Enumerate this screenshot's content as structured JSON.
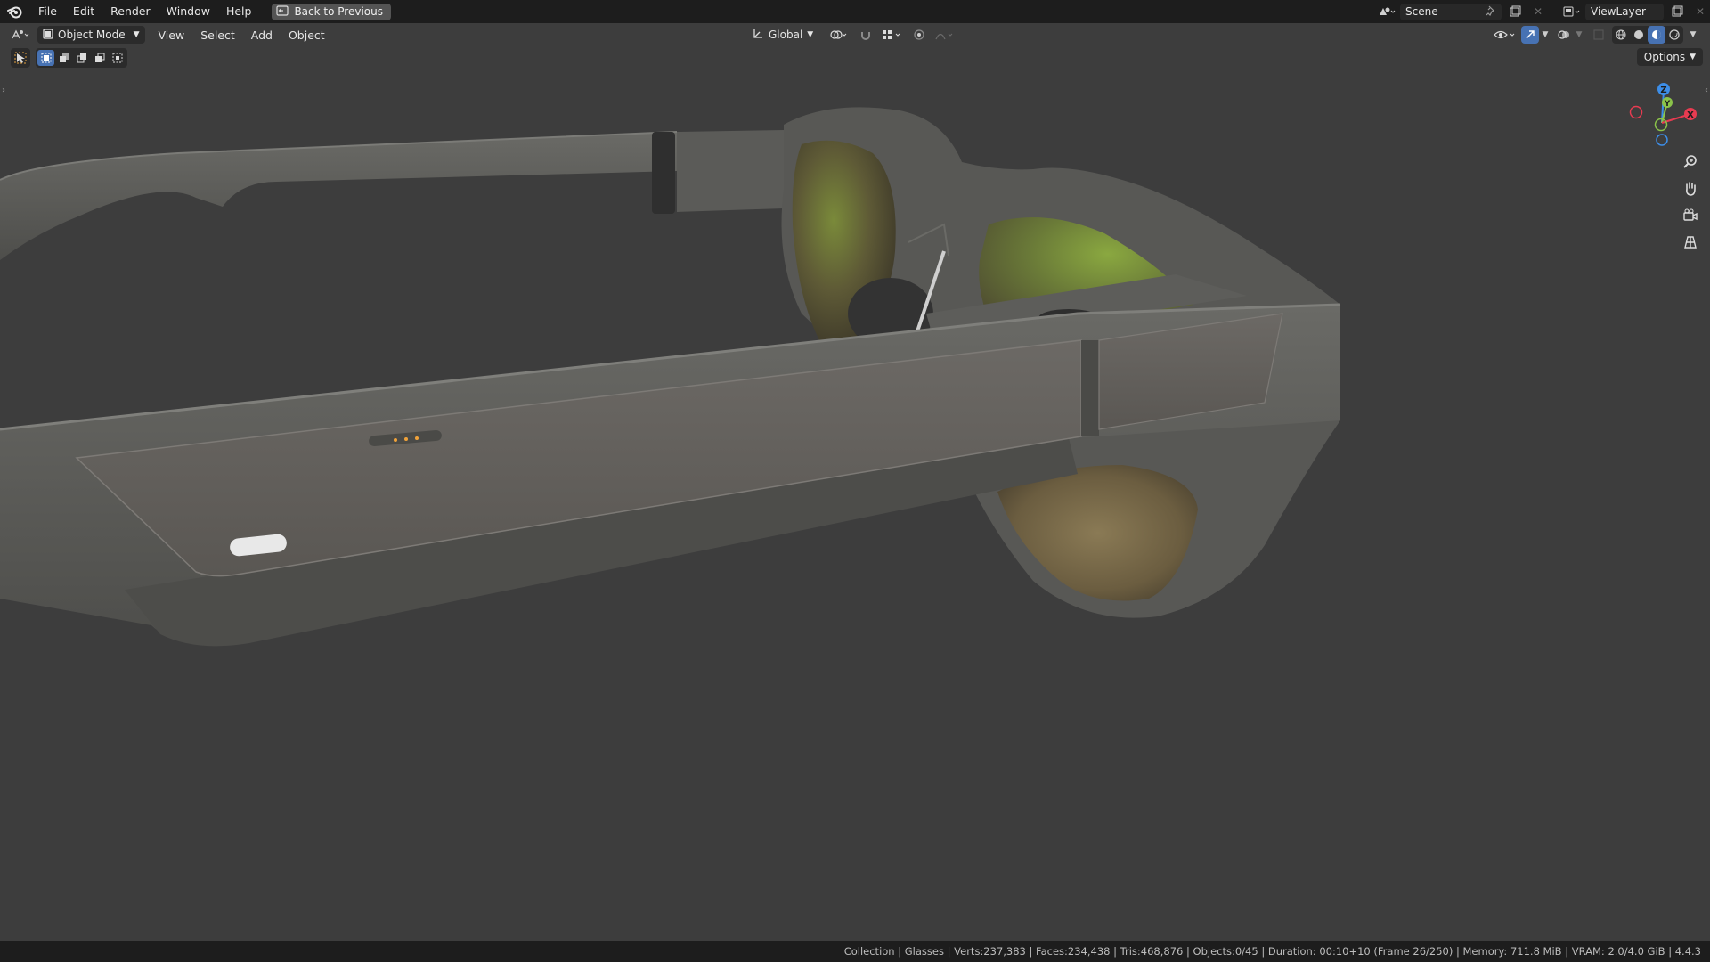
{
  "menubar": {
    "items": [
      "File",
      "Edit",
      "Render",
      "Window",
      "Help"
    ],
    "back_button": "Back to Previous"
  },
  "scene_selector": {
    "value": "Scene"
  },
  "viewlayer_selector": {
    "value": "ViewLayer"
  },
  "viewport_header": {
    "mode": "Object Mode",
    "menus": [
      "View",
      "Select",
      "Add",
      "Object"
    ],
    "transform_orientation": "Global"
  },
  "toolbar": {
    "options_label": "Options"
  },
  "gizmo": {
    "axes": [
      "X",
      "Y",
      "Z"
    ]
  },
  "statusbar": {
    "text": "Collection | Glasses | Verts:237,383 | Faces:234,438 | Tris:468,876 | Objects:0/45 | Duration: 00:10+10 (Frame 26/250) | Memory: 711.8 MiB | VRAM: 2.0/4.0 GiB | 4.4.3"
  },
  "colors": {
    "accent": "#4772b3",
    "x_axis": "#e83b51",
    "y_axis": "#8bc34a",
    "z_axis": "#3d8ee8",
    "viewport_bg": "#3d3d3d"
  },
  "icons": [
    "blender-logo-icon",
    "editor-type-icon",
    "object-mode-icon",
    "orientation-icon",
    "pivot-icon",
    "snap-icon",
    "proportional-edit-icon",
    "visibility-icon",
    "gizmo-icon",
    "overlay-icon",
    "xray-icon",
    "wireframe-shading-icon",
    "solid-shading-icon",
    "material-shading-icon",
    "rendered-shading-icon",
    "zoom-icon",
    "hand-icon",
    "camera-icon",
    "grid-icon"
  ]
}
